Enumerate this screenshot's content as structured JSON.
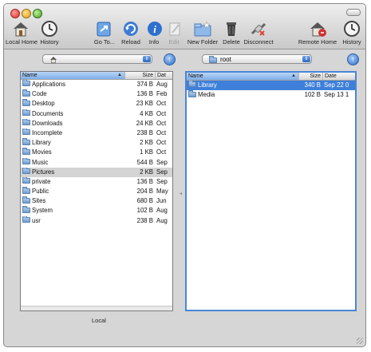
{
  "toolbar": {
    "buttons": [
      {
        "label": "Local Home",
        "icon": "home-icon"
      },
      {
        "label": "History",
        "icon": "clock-icon"
      },
      {
        "label": "Go To...",
        "icon": "goto-icon"
      },
      {
        "label": "Reload",
        "icon": "reload-icon"
      },
      {
        "label": "Info",
        "icon": "info-icon"
      },
      {
        "label": "Edit",
        "icon": "edit-icon"
      },
      {
        "label": "New Folder",
        "icon": "new-folder-icon"
      },
      {
        "label": "Delete",
        "icon": "trash-icon"
      },
      {
        "label": "Disconnect",
        "icon": "disconnect-icon"
      },
      {
        "label": "Remote Home",
        "icon": "remote-home-icon"
      },
      {
        "label": "History",
        "icon": "clock-icon"
      }
    ]
  },
  "local": {
    "path": "",
    "columns": {
      "name": "Name",
      "size": "Size",
      "date": "Dat"
    },
    "rows": [
      {
        "name": "Applications",
        "size": "374 B",
        "date": "Aug"
      },
      {
        "name": "Code",
        "size": "136 B",
        "date": "Feb"
      },
      {
        "name": "Desktop",
        "size": "23 KB",
        "date": "Oct"
      },
      {
        "name": "Documents",
        "size": "4 KB",
        "date": "Oct"
      },
      {
        "name": "Downloads",
        "size": "24 KB",
        "date": "Oct"
      },
      {
        "name": "Incomplete",
        "size": "238 B",
        "date": "Oct"
      },
      {
        "name": "Library",
        "size": "2 KB",
        "date": "Oct"
      },
      {
        "name": "Movies",
        "size": "1 KB",
        "date": "Oct"
      },
      {
        "name": "Music",
        "size": "544 B",
        "date": "Sep"
      },
      {
        "name": "Pictures",
        "size": "2 KB",
        "date": "Sep"
      },
      {
        "name": "private",
        "size": "136 B",
        "date": "Sep"
      },
      {
        "name": "Public",
        "size": "204 B",
        "date": "May"
      },
      {
        "name": "Sites",
        "size": "680 B",
        "date": "Jun"
      },
      {
        "name": "System",
        "size": "102 B",
        "date": "Aug"
      },
      {
        "name": "usr",
        "size": "238 B",
        "date": "Aug"
      }
    ],
    "status": "Local"
  },
  "remote": {
    "path": "root",
    "columns": {
      "name": "Name",
      "size": "Size",
      "date": "Date"
    },
    "rows": [
      {
        "name": "Library",
        "size": "340 B",
        "date": "Sep 22 0"
      },
      {
        "name": "Media",
        "size": "102 B",
        "date": "Sep 13 1"
      }
    ]
  },
  "colors": {
    "selection": "#3e7fd9",
    "accent": "#4a86d6"
  }
}
